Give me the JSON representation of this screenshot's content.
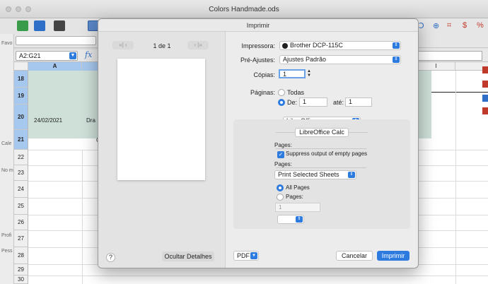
{
  "window": {
    "title": "Colors Handmade.ods"
  },
  "formula_bar": {
    "name_box": "A2:G21",
    "fx_symbol": "fx"
  },
  "sidebar": {
    "labels": [
      "Favo",
      "Cale",
      "No m",
      "Profi",
      "Pess"
    ]
  },
  "grid": {
    "columns": [
      "A",
      "I"
    ],
    "rows": [
      "18",
      "19",
      "20",
      "21",
      "22",
      "23",
      "24",
      "25",
      "26",
      "27",
      "28",
      "29",
      "30"
    ],
    "cells": {
      "a20": "24/02/2021",
      "b20_partial": "Dra",
      "b21_partial": "C"
    }
  },
  "dialog": {
    "title": "Imprimir",
    "preview": {
      "page_count": "1 de 1",
      "first_prev": "«|  ‹",
      "next_last": "›  |»"
    },
    "printer_label": "Impressora:",
    "printer_value": "Brother DCP-115C",
    "presets_label": "Pré-Ajustes:",
    "presets_value": "Ajustes Padrão",
    "copies_label": "Cópias:",
    "copies_value": "1",
    "pages_label": "Páginas:",
    "pages_all": "Todas",
    "pages_from": "De:",
    "pages_from_value": "1",
    "pages_to": "até:",
    "pages_to_value": "1",
    "app_popup": "LibreOffice",
    "calc_button": "LibreOffice Calc",
    "group1_title": "Pages:",
    "suppress_label": "Suppress output of empty pages",
    "group2_title": "Pages:",
    "print_selection": "Print Selected Sheets",
    "all_pages": "All Pages",
    "pages_option": "Pages:",
    "pages_field_placeholder": "1",
    "help": "?",
    "details_button": "Ocultar Detalhes",
    "pdf": "PDF",
    "cancel": "Cancelar",
    "print": "Imprimir"
  }
}
